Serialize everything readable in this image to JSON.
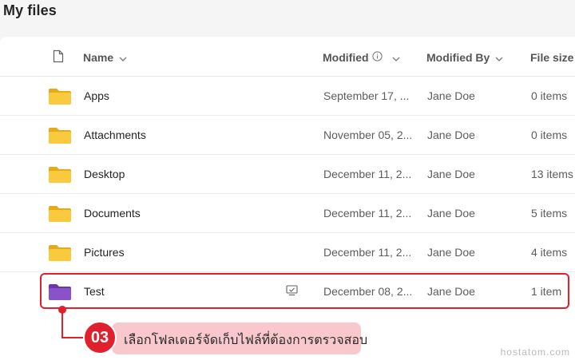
{
  "page": {
    "title": "My files"
  },
  "columns": {
    "file_type_icon": "file-icon",
    "name": "Name",
    "modified": "Modified",
    "modified_by": "Modified By",
    "file_size": "File size"
  },
  "rows": [
    {
      "name": "Apps",
      "modified": "September 17, ...",
      "modified_by": "Jane Doe",
      "size": "0 items",
      "icon": "folder-icon",
      "color": "#f5c242"
    },
    {
      "name": "Attachments",
      "modified": "November 05, 2...",
      "modified_by": "Jane Doe",
      "size": "0 items",
      "icon": "folder-icon",
      "color": "#f5c242"
    },
    {
      "name": "Desktop",
      "modified": "December 11, 2...",
      "modified_by": "Jane Doe",
      "size": "13 items",
      "icon": "folder-icon",
      "color": "#f5c242"
    },
    {
      "name": "Documents",
      "modified": "December 11, 2...",
      "modified_by": "Jane Doe",
      "size": "5 items",
      "icon": "folder-icon",
      "color": "#f5c242"
    },
    {
      "name": "Pictures",
      "modified": "December 11, 2...",
      "modified_by": "Jane Doe",
      "size": "4 items",
      "icon": "folder-icon",
      "color": "#f5c242"
    },
    {
      "name": "Test",
      "modified": "December 08, 2...",
      "modified_by": "Jane Doe",
      "size": "1 item",
      "icon": "folder-icon",
      "color": "#8a52c8",
      "extra_icon": "shared-icon"
    }
  ],
  "annotation": {
    "step": "03",
    "text": "เลือกโฟลเดอร์จัดเก็บไฟล์ที่ต้องการตรวจสอบ",
    "accent": "#e0202d",
    "bubble": "#f8c8cc"
  },
  "watermark": "hostatom.com"
}
